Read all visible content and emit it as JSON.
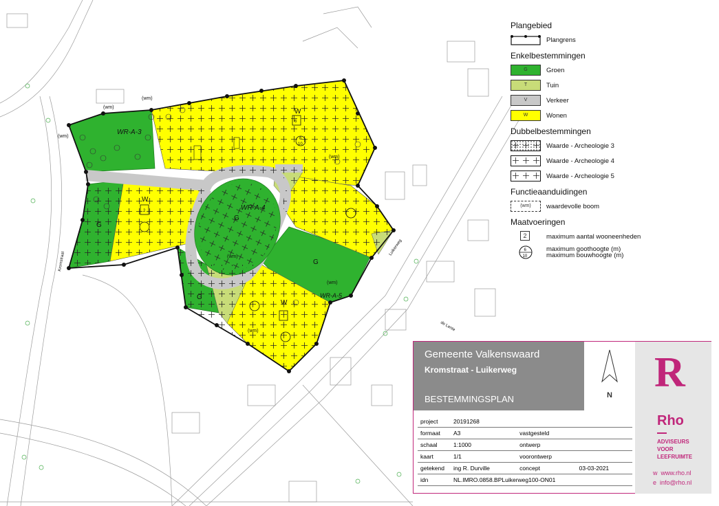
{
  "map": {
    "labels": {
      "wr_a3_top": "WR-A-3",
      "wr_a4": "WR-A-4",
      "wr_a5": "WR-A-5",
      "g": "G",
      "w": "W",
      "wm": "(wm)",
      "n2": "2",
      "h6": "6",
      "h10": "10",
      "road_left": "Kromstraat",
      "road_right": "Luikerweg",
      "road_lower": "de Lente"
    }
  },
  "legend": {
    "sections": [
      {
        "title": "Plangebied",
        "items": [
          {
            "label": "Plangrens",
            "swatch": "plangrens"
          }
        ]
      },
      {
        "title": "Enkelbestemmingen",
        "items": [
          {
            "label": "Groen",
            "code": "G",
            "color": "#2fb22f"
          },
          {
            "label": "Tuin",
            "code": "T",
            "color": "#c8dc78"
          },
          {
            "label": "Verkeer",
            "code": "V",
            "color": "#c8c8c8"
          },
          {
            "label": "Wonen",
            "code": "W",
            "color": "#ffff00"
          }
        ]
      },
      {
        "title": "Dubbelbestemmingen",
        "items": [
          {
            "label": "Waarde - Archeologie 3",
            "swatch": "arch3"
          },
          {
            "label": "Waarde - Archeologie 4",
            "swatch": "arch4"
          },
          {
            "label": "Waarde - Archeologie 5",
            "swatch": "arch5"
          }
        ]
      },
      {
        "title": "Functieaanduidingen",
        "items": [
          {
            "label": "waardevolle boom",
            "code": "(wm)",
            "swatch": "boom"
          }
        ]
      },
      {
        "title": "Maatvoeringen",
        "items": [
          {
            "label": "maximum aantal wooneenheden",
            "code": "2",
            "swatch": "box"
          },
          {
            "label": "maximum goothoogte (m)",
            "label2": "maximum bouwhoogte (m)",
            "code": "6",
            "code2": "10",
            "swatch": "circle"
          }
        ]
      }
    ]
  },
  "titleblock": {
    "municipality": "Gemeente Valkenswaard",
    "plan_name": "Kromstraat - Luikerweg",
    "plan_type": "BESTEMMINGSPLAN",
    "north": "N",
    "rows": [
      {
        "key": "project",
        "value": "20191268",
        "status": "",
        "date": ""
      },
      {
        "key": "formaat",
        "value": "A3",
        "status": "vastgesteld",
        "date": ""
      },
      {
        "key": "schaal",
        "value": "1:1000",
        "status": "ontwerp",
        "date": ""
      },
      {
        "key": "kaart",
        "value": "1/1",
        "status": "voorontwerp",
        "date": ""
      },
      {
        "key": "getekend",
        "value": "ing R. Durville",
        "status": "concept",
        "date": "03-03-2021"
      },
      {
        "key": "idn",
        "value": "NL.IMRO.0858.BPLuikerweg100-ON01",
        "status": "",
        "date": ""
      }
    ],
    "logo": {
      "letter": "R",
      "name": "Rho",
      "tagline": [
        "ADVISEURS",
        "VOOR",
        "LEEFRUIMTE"
      ],
      "web_prefix": "w",
      "web": "www.rho.nl",
      "email_prefix": "e",
      "email": "info@rho.nl",
      "color": "#c0267a"
    }
  }
}
